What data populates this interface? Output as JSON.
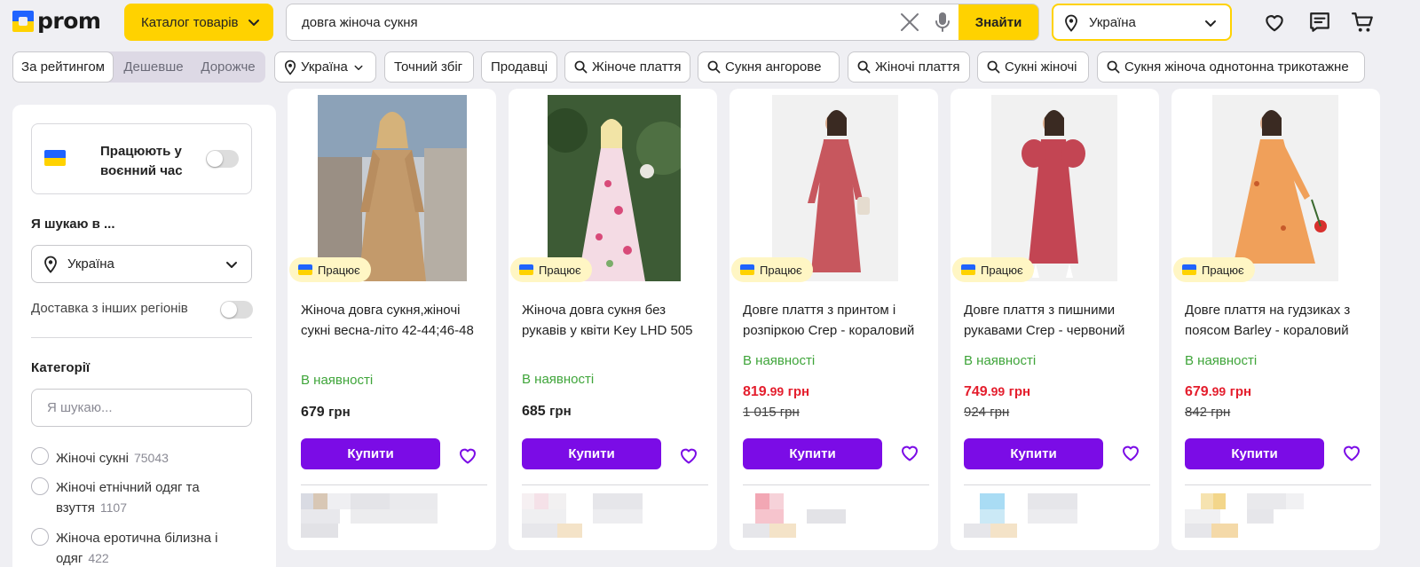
{
  "header": {
    "logo_text": "prom",
    "catalog_label": "Каталог товарів",
    "search_value": "довга жіноча сукня",
    "search_button": "Знайти",
    "region": "Україна",
    "icons": [
      "heart-icon",
      "chat-icon",
      "cart-icon"
    ]
  },
  "filters": {
    "sort": [
      "За рейтингом",
      "Дешевше",
      "Дорожче"
    ],
    "sort_active": "За рейтингом",
    "region_chip": "Україна",
    "chips": [
      "Точний збіг",
      "Продавці"
    ],
    "suggestions": [
      "Жіноче плаття",
      "Сукня ангорове",
      "Жіночі плаття",
      "Сукні жіночі",
      "Сукня жіноча однотонна трикотажне"
    ]
  },
  "sidebar": {
    "wartime_label": "Працюють у воєнний час",
    "search_in_title": "Я шукаю в ...",
    "region_value": "Україна",
    "delivery_label": "Доставка з інших регіонів",
    "categories_title": "Категорії",
    "category_placeholder": "Я шукаю...",
    "categories": [
      {
        "label": "Жіночі сукні",
        "count": "75043"
      },
      {
        "label": "Жіночі етнічний одяг та взуття",
        "count": "1107"
      },
      {
        "label": "Жіноча еротична білизна і одяг",
        "count": "422"
      }
    ]
  },
  "products": [
    {
      "badge": "Працює",
      "title": "Жіноча довга сукня,жіночі сукні весна-літо 42-44;46-48",
      "availability": "В наявності",
      "price": "679",
      "cents": "",
      "currency": "грн",
      "old_price": "",
      "buy": "Купити"
    },
    {
      "badge": "Працює",
      "title": "Жіноча довга сукня без рукавів у квіти Key LHD 505",
      "availability": "В наявності",
      "price": "685",
      "cents": "",
      "currency": "грн",
      "old_price": "",
      "buy": "Купити"
    },
    {
      "badge": "Працює",
      "title": "Довге плаття з принтом і розпіркою Crep - кораловий",
      "availability": "В наявності",
      "price": "819",
      "cents": ".99",
      "currency": "грн",
      "old_price": "1 015 грн",
      "buy": "Купити"
    },
    {
      "badge": "Працює",
      "title": "Довге плаття з пишними рукавами Crep - червоний",
      "availability": "В наявності",
      "price": "749",
      "cents": ".99",
      "currency": "грн",
      "old_price": "924 грн",
      "buy": "Купити"
    },
    {
      "badge": "Працює",
      "title": "Довге плаття на гудзиках з поясом Barley - кораловий",
      "availability": "В наявності",
      "price": "679",
      "cents": ".99",
      "currency": "грн",
      "old_price": "842 грн",
      "buy": "Купити"
    }
  ],
  "colors": {
    "accent_yellow": "#ffd200",
    "buy_purple": "#7b0ce6",
    "sale_red": "#e41e2d",
    "in_stock_green": "#3fa53a"
  }
}
